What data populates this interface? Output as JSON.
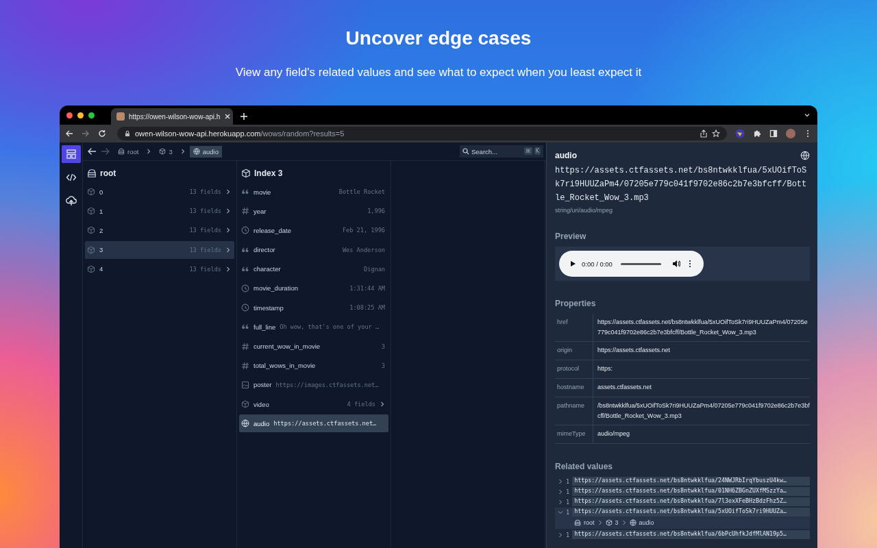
{
  "page": {
    "title": "Uncover edge cases",
    "subtitle": "View any field's related values and see what to expect when you least expect it"
  },
  "browser": {
    "tab_title": "https://owen-wilson-wow-api.h",
    "url_host": "owen-wilson-wow-api.herokuapp.com",
    "url_path": "/wows/random?results=5"
  },
  "rail": [
    {
      "kind": "layout",
      "selected": true
    },
    {
      "kind": "code",
      "selected": false
    },
    {
      "kind": "tree",
      "selected": false
    }
  ],
  "breadcrumbs": [
    {
      "kind": "root",
      "label": "root",
      "selected": false
    },
    {
      "kind": "object",
      "label": "3",
      "selected": false
    },
    {
      "kind": "uri",
      "label": "audio",
      "selected": true
    }
  ],
  "search": {
    "placeholder": "Search...",
    "shortcut": [
      "⌘",
      "K"
    ]
  },
  "root_column": {
    "title": "root",
    "items": [
      {
        "label": "0",
        "summary": "13 fields",
        "selected": false
      },
      {
        "label": "1",
        "summary": "13 fields",
        "selected": false
      },
      {
        "label": "2",
        "summary": "13 fields",
        "selected": false
      },
      {
        "label": "3",
        "summary": "13 fields",
        "selected": true
      },
      {
        "label": "4",
        "summary": "13 fields",
        "selected": false
      }
    ]
  },
  "index_column": {
    "title": "Index 3",
    "fields": [
      {
        "kind": "string",
        "name": "movie",
        "value": "Bottle Rocket",
        "inline": false,
        "selected": false
      },
      {
        "kind": "number",
        "name": "year",
        "value": "1,996",
        "inline": false,
        "selected": false
      },
      {
        "kind": "date",
        "name": "release_date",
        "value": "Feb 21, 1996",
        "inline": false,
        "selected": false
      },
      {
        "kind": "string",
        "name": "director",
        "value": "Wes Anderson",
        "inline": false,
        "selected": false
      },
      {
        "kind": "string",
        "name": "character",
        "value": "Dignan",
        "inline": false,
        "selected": false
      },
      {
        "kind": "date",
        "name": "movie_duration",
        "value": "1:31:44 AM",
        "inline": false,
        "selected": false
      },
      {
        "kind": "date",
        "name": "timestamp",
        "value": "1:08:25 AM",
        "inline": false,
        "selected": false
      },
      {
        "kind": "string",
        "name": "full_line",
        "value": "Oh wow, that's one of your …",
        "inline": true,
        "selected": false
      },
      {
        "kind": "number",
        "name": "current_wow_in_movie",
        "value": "3",
        "inline": false,
        "selected": false
      },
      {
        "kind": "number",
        "name": "total_wows_in_movie",
        "value": "3",
        "inline": false,
        "selected": false
      },
      {
        "kind": "image",
        "name": "poster",
        "value": "https://images.ctfassets.net…",
        "inline": true,
        "selected": false
      },
      {
        "kind": "object",
        "name": "video",
        "value": "4 fields",
        "inline": false,
        "selected": false
      },
      {
        "kind": "uri",
        "name": "audio",
        "value": "https://assets.ctfassets.net…",
        "inline": true,
        "selected": true
      }
    ]
  },
  "detail": {
    "title": "audio",
    "value": "https://assets.ctfassets.net/bs8ntwkklfua/5xUOifToSk7ri9HUUZaPm4/07205e779c041f9702e86c2b7e3bfcff/Bottle_Rocket_Wow_3.mp3",
    "type": "string/uri/audio/mpeg",
    "preview_heading": "Preview",
    "audio_time": "0:00 / 0:00",
    "properties_heading": "Properties",
    "properties": [
      {
        "key": "href",
        "value": "https://assets.ctfassets.net/bs8ntwkklfua/5xUOifToSk7ri9HUUZaPm4/07205e779c041f9702e86c2b7e3bfcff/Bottle_Rocket_Wow_3.mp3"
      },
      {
        "key": "origin",
        "value": "https://assets.ctfassets.net"
      },
      {
        "key": "protocol",
        "value": "https:"
      },
      {
        "key": "hostname",
        "value": "assets.ctfassets.net"
      },
      {
        "key": "pathname",
        "value": "/bs8ntwkklfua/5xUOifToSk7ri9HUUZaPm4/07205e779c041f9702e86c2b7e3bfcff/Bottle_Rocket_Wow_3.mp3"
      },
      {
        "key": "mimeType",
        "value": "audio/mpeg"
      }
    ],
    "related_heading": "Related values",
    "related": [
      {
        "count": "1",
        "value": "https://assets.ctfassets.net/bs8ntwkklfua/24NWJRbIrqYbuszU4kw…",
        "expanded": false
      },
      {
        "count": "1",
        "value": "https://assets.ctfassets.net/bs8ntwkklfua/01NH6ZBGnZUXfMSzzYa…",
        "expanded": false
      },
      {
        "count": "1",
        "value": "https://assets.ctfassets.net/bs8ntwkklfua/7l3exXFeBHzBdzFhz5Z…",
        "expanded": false
      },
      {
        "count": "1",
        "value": "https://assets.ctfassets.net/bs8ntwkklfua/5xUOifToSk7ri9HUUZa…",
        "expanded": true,
        "path": [
          {
            "kind": "root",
            "label": "root"
          },
          {
            "kind": "object",
            "label": "3"
          },
          {
            "kind": "uri",
            "label": "audio"
          }
        ]
      },
      {
        "count": "1",
        "value": "https://assets.ctfassets.net/bs8ntwkklfua/6bPcUhfkJdfMlAN19p5…",
        "expanded": false
      }
    ]
  }
}
